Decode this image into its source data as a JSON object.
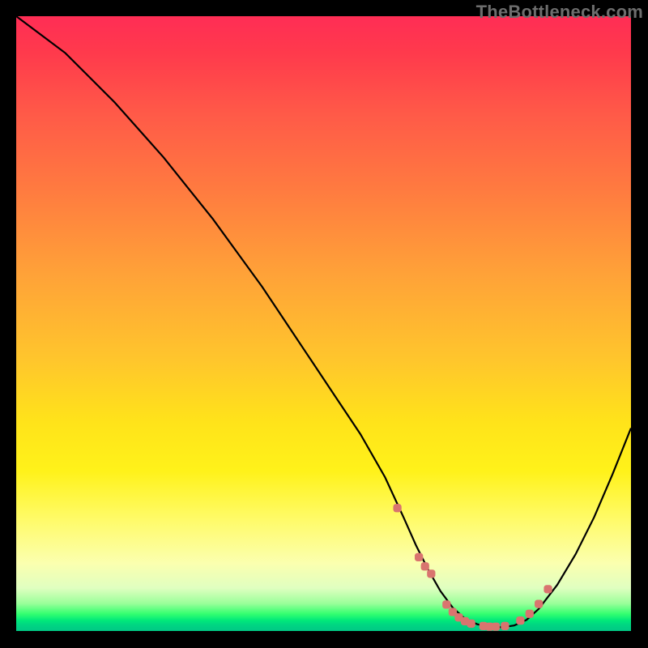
{
  "watermark": "TheBottleneck.com",
  "chart_data": {
    "type": "line",
    "title": "",
    "xlabel": "",
    "ylabel": "",
    "xlim": [
      0,
      100
    ],
    "ylim": [
      0,
      100
    ],
    "grid": false,
    "legend": false,
    "background": "vertical-gradient red→yellow→green",
    "series": [
      {
        "name": "curve",
        "color": "#000000",
        "x": [
          0,
          4,
          8,
          12,
          16,
          20,
          24,
          28,
          32,
          36,
          40,
          44,
          48,
          52,
          56,
          60,
          63,
          65,
          67,
          69,
          71,
          73,
          75,
          77,
          79,
          81,
          83,
          85,
          88,
          91,
          94,
          97,
          100
        ],
        "values": [
          100,
          97,
          94,
          90,
          86,
          81.5,
          77,
          72,
          67,
          61.5,
          56,
          50,
          44,
          38,
          32,
          25,
          18.5,
          14,
          10,
          6.5,
          3.8,
          2.0,
          1.1,
          0.7,
          0.6,
          0.9,
          1.8,
          3.6,
          7.5,
          12.5,
          18.5,
          25.5,
          33
        ]
      }
    ],
    "markers": {
      "name": "bottom-dots",
      "color": "#d9746f",
      "shape": "rounded-square",
      "x": [
        62,
        65.5,
        66.5,
        67.5,
        70,
        71,
        72,
        73,
        74,
        76,
        77,
        78,
        79.5,
        82,
        83.5,
        85,
        86.5
      ],
      "values": [
        20,
        12,
        10.5,
        9.3,
        4.3,
        3.1,
        2.2,
        1.6,
        1.2,
        0.8,
        0.7,
        0.7,
        0.8,
        1.7,
        2.8,
        4.4,
        6.8
      ]
    }
  }
}
